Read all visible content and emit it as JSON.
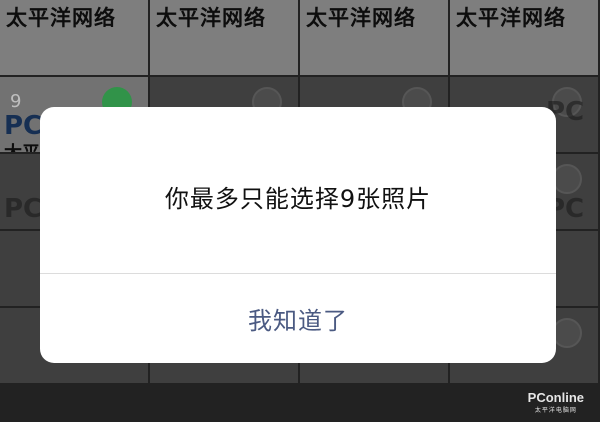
{
  "grid": {
    "tile_label": "太平洋网络",
    "count_label": "9"
  },
  "dialog": {
    "message": "你最多只能选择9张照片",
    "button_label": "我知道了"
  },
  "watermark": {
    "brand": "PConline",
    "subtitle": "太平洋电脑网"
  },
  "colors": {
    "dialog_bg": "#ffffff",
    "button_text": "#4b5a82",
    "message_text": "#111111",
    "badge_green": "#3cb45a"
  }
}
